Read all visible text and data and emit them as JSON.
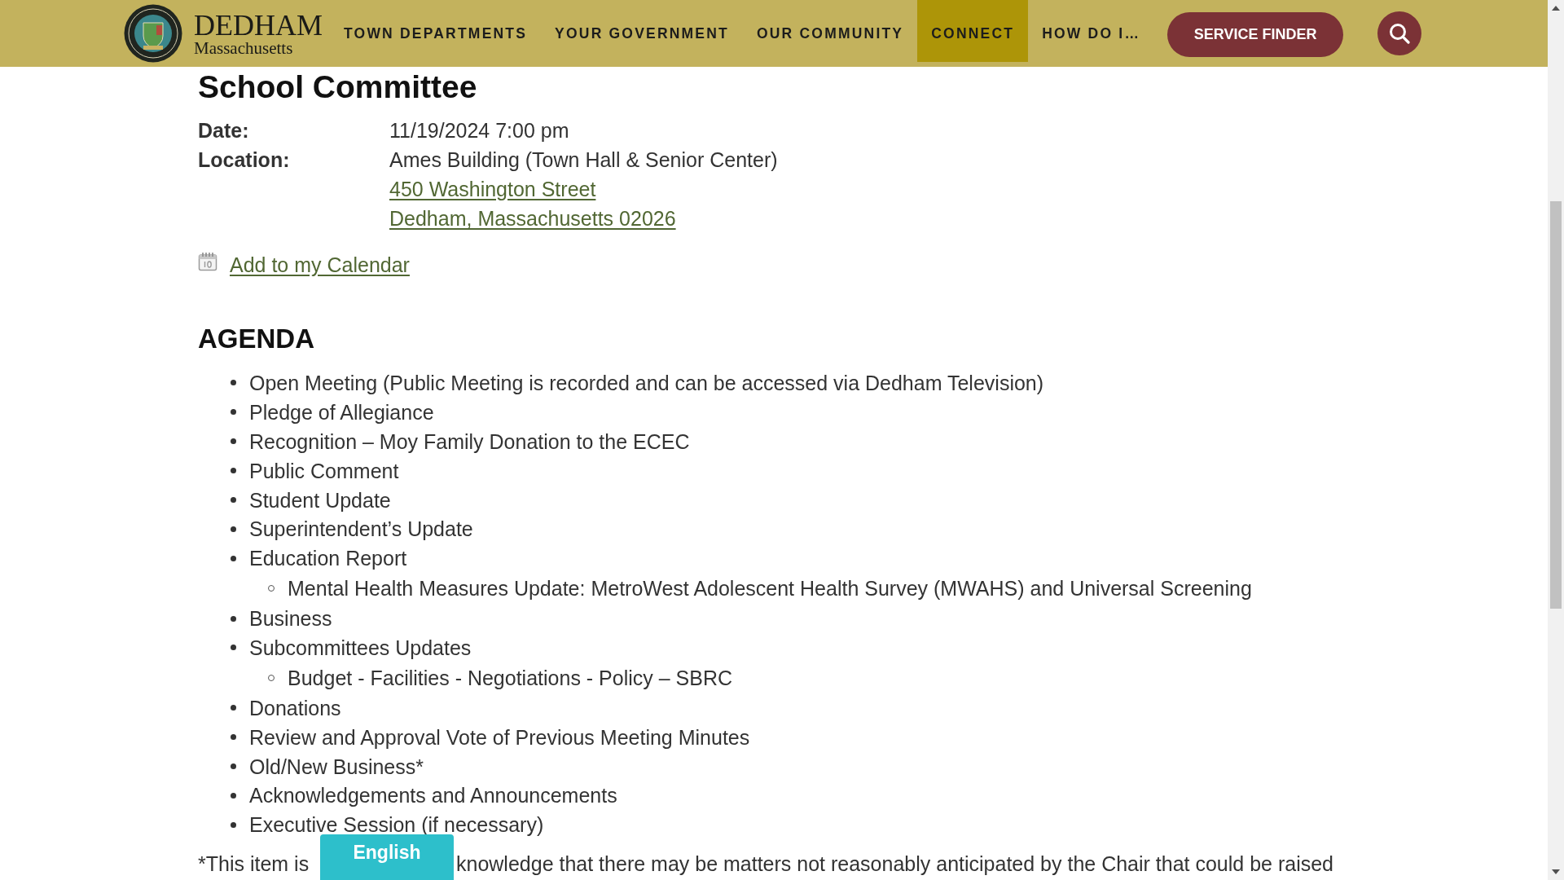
{
  "header": {
    "logo": {
      "name": "DEDHAM",
      "subtitle": "Massachusetts"
    },
    "nav": [
      {
        "label": "TOWN DEPARTMENTS",
        "selected": false
      },
      {
        "label": "YOUR GOVERNMENT",
        "selected": false
      },
      {
        "label": "OUR COMMUNITY",
        "selected": false
      },
      {
        "label": "CONNECT",
        "selected": true
      },
      {
        "label": "HOW DO I…",
        "selected": false
      }
    ],
    "service_finder": "SERVICE FINDER"
  },
  "meeting": {
    "title": "School Committee",
    "details": [
      {
        "label": "Date:",
        "lines": [
          {
            "kind": "text",
            "text": "11/19/2024 7:00 pm"
          }
        ]
      },
      {
        "label": "Location:",
        "lines": [
          {
            "kind": "text",
            "text": "Ames Building (Town Hall & Senior Center)"
          },
          {
            "kind": "link",
            "text": "450 Washington Street"
          },
          {
            "kind": "link",
            "text": "Dedham, Massachusetts 02026"
          }
        ]
      }
    ],
    "calendar_link": "Add to my Calendar"
  },
  "agenda": {
    "heading": "AGENDA",
    "items": [
      {
        "text": "Open Meeting (Public Meeting is recorded and can be accessed via Dedham Television)"
      },
      {
        "text": "Pledge of Allegiance"
      },
      {
        "text": "Recognition – Moy Family Donation to the ECEC"
      },
      {
        "text": "Public Comment"
      },
      {
        "text": "Student Update"
      },
      {
        "text": "Superintendent’s Update"
      },
      {
        "text": "Education Report",
        "children": [
          {
            "text": "Mental Health Measures Update: MetroWest Adolescent Health Survey (MWAHS) and Universal Screening"
          }
        ]
      },
      {
        "text": "Business"
      },
      {
        "text": "Subcommittees Updates",
        "children": [
          {
            "text": "Budget - Facilities - Negotiations - Policy – SBRC"
          }
        ]
      },
      {
        "text": "Donations"
      },
      {
        "text": "Review and Approval Vote of Previous Meeting Minutes"
      },
      {
        "text": "Old/New Business*"
      },
      {
        "text": "Acknowledgements and Announcements"
      },
      {
        "text": "Executive Session (if necessary)"
      }
    ]
  },
  "footnote": {
    "segments": [
      "*This item is",
      "knowledge that there may be matters not reasonably anticipated by the Chair that could be raised"
    ]
  },
  "language_button": "English"
}
